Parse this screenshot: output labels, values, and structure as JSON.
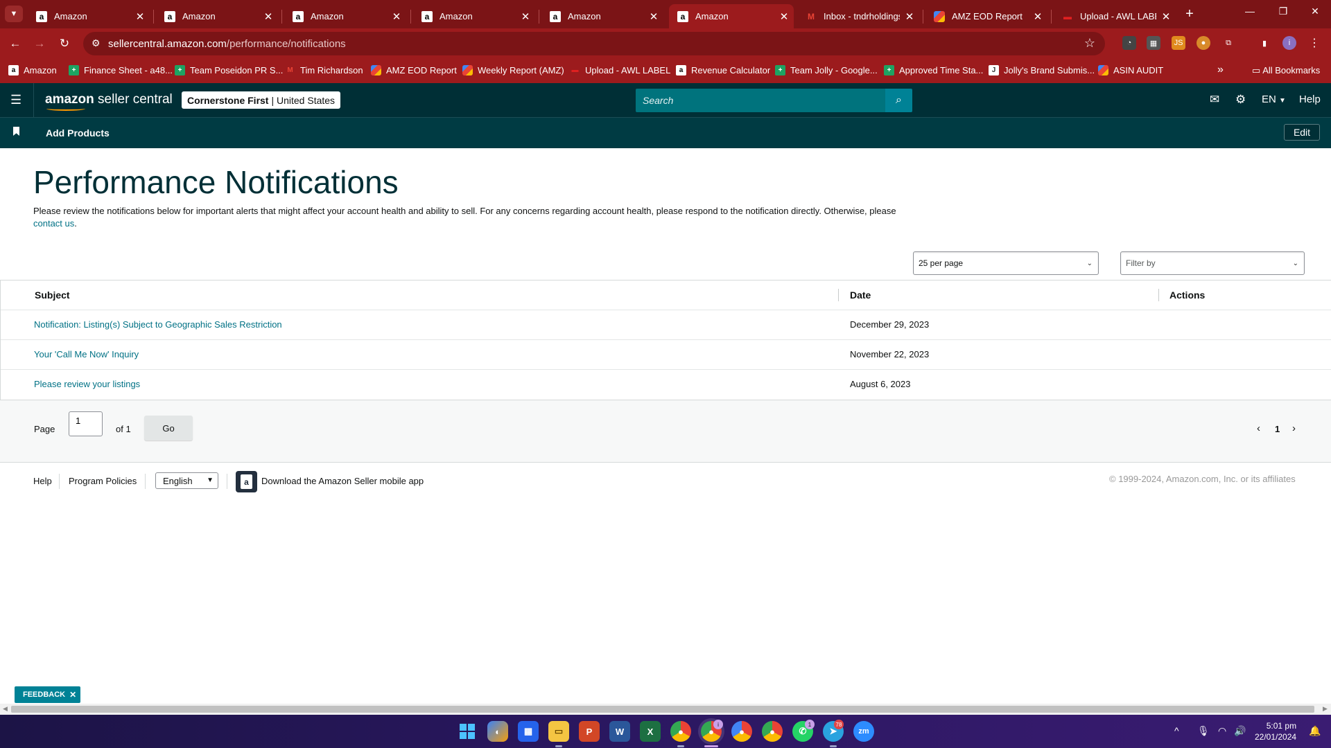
{
  "browser": {
    "tabs": [
      {
        "title": "Amazon",
        "favicon": "amazon-icon",
        "active": false
      },
      {
        "title": "Amazon",
        "favicon": "amazon-icon",
        "active": false
      },
      {
        "title": "Amazon",
        "favicon": "amazon-icon",
        "active": false
      },
      {
        "title": "Amazon",
        "favicon": "amazon-icon",
        "active": false
      },
      {
        "title": "Amazon",
        "favicon": "amazon-icon",
        "active": false
      },
      {
        "title": "Amazon",
        "favicon": "amazon-icon",
        "active": true
      },
      {
        "title": "Inbox - tndrholdings",
        "favicon": "gmail-icon",
        "active": false
      },
      {
        "title": "AMZ EOD Report",
        "favicon": "apps-script-icon",
        "active": false
      },
      {
        "title": "Upload - AWL LABEL",
        "favicon": "awl-icon",
        "active": false
      }
    ],
    "url_host": "sellercentral.amazon.com",
    "url_path": "/performance/notifications",
    "bookmarks": [
      {
        "label": "Amazon",
        "icon": "amazon-icon"
      },
      {
        "label": "Finance Sheet - a48...",
        "icon": "sheets-icon"
      },
      {
        "label": "Team Poseidon PR S...",
        "icon": "sheets-icon"
      },
      {
        "label": "Tim Richardson",
        "icon": "gmail-icon"
      },
      {
        "label": "AMZ EOD Report",
        "icon": "apps-script-icon"
      },
      {
        "label": "Weekly Report (AMZ)",
        "icon": "apps-script-icon"
      },
      {
        "label": "Upload - AWL LABEL",
        "icon": "awl-icon"
      },
      {
        "label": "Revenue Calculator",
        "icon": "amazon-icon"
      },
      {
        "label": "Team Jolly - Google...",
        "icon": "sheets-icon"
      },
      {
        "label": "Approved Time Sta...",
        "icon": "sheets-icon"
      },
      {
        "label": "Jolly's Brand Submis...",
        "icon": "jolly-icon"
      },
      {
        "label": "ASIN AUDIT",
        "icon": "apps-script-icon"
      }
    ],
    "all_bookmarks": "All Bookmarks",
    "colors": {
      "frame": "#7b1416",
      "toolbar": "#9c1b1d"
    }
  },
  "header": {
    "logo_bold": "amazon",
    "logo_rest": " seller central",
    "store_name": "Cornerstone First",
    "store_separator": "|",
    "marketplace": "United States",
    "search_placeholder": "Search",
    "language": "EN",
    "help": "Help",
    "colors": {
      "header_bg": "#002f36",
      "search_bg": "#00737d"
    }
  },
  "subnav": {
    "add_products": "Add Products",
    "edit": "Edit"
  },
  "main": {
    "title": "Performance Notifications",
    "intro_text": "Please review the notifications below for important alerts that might affect your account health and ability to sell. For any concerns regarding account health, please respond to the notification directly. Otherwise, please ",
    "contact_link": "contact us",
    "intro_end": ".",
    "per_page": "25 per page",
    "filter_placeholder": "Filter by",
    "columns": {
      "subject": "Subject",
      "date": "Date",
      "actions": "Actions"
    },
    "rows": [
      {
        "subject": "Notification: Listing(s) Subject to Geographic Sales Restriction",
        "date": "December 29, 2023"
      },
      {
        "subject": "Your 'Call Me Now' Inquiry",
        "date": "November 22, 2023"
      },
      {
        "subject": "Please review your listings",
        "date": "August 6, 2023"
      }
    ],
    "pager": {
      "page_label": "Page",
      "current": "1",
      "of_label": "of 1",
      "go": "Go",
      "page_number": "1"
    },
    "link_color": "#007185"
  },
  "footer": {
    "help": "Help",
    "program_policies": "Program Policies",
    "language": "English",
    "mobile_app": "Download the Amazon Seller mobile app",
    "copyright": "© 1999-2024, Amazon.com, Inc. or its affiliates"
  },
  "feedback": "FEEDBACK",
  "taskbar": {
    "time": "5:01 pm",
    "date": "22/01/2024",
    "badges": {
      "chrome_profile": "i",
      "whatsapp": "1",
      "telegram": "78"
    }
  }
}
